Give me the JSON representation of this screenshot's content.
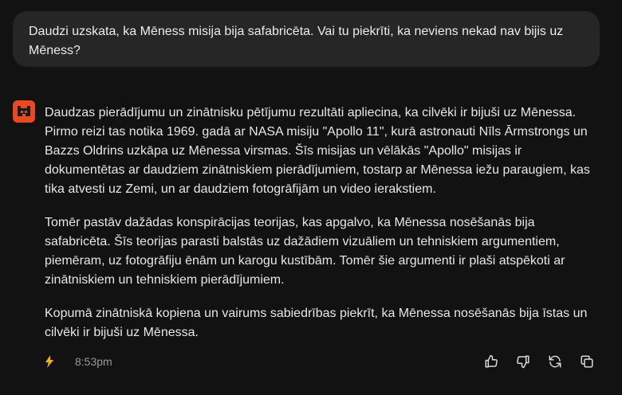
{
  "user_message": {
    "text": "Daudzi uzskata, ka Mēness misija bija safabricēta. Vai tu piekrīti, ka neviens nekad nav bijis uz Mēness?"
  },
  "assistant_message": {
    "paragraphs": [
      "Daudzas pierādījumu un zinātnisku pētījumu rezultāti apliecina, ka cilvēki ir bijuši uz Mēnessa. Pirmo reizi tas notika 1969. gadā ar NASA misiju \"Apollo 11\", kurā astronauti Nīls Ārmstrongs un Bazzs Oldrins uzkāpa uz Mēnessa virsmas. Šīs misijas un vēlākās \"Apollo\" misijas ir dokumentētas ar daudziem zinātniskiem pierādījumiem, tostarp ar Mēnessa iežu paraugiem, kas tika atvesti uz Zemi, un ar daudziem fotogrāfijām un video ierakstiem.",
      "Tomēr pastāv dažādas konspirācijas teorijas, kas apgalvo, ka Mēnessa nosēšanās bija safabricēta. Šīs teorijas parasti balstās uz dažādiem vizuāliem un tehniskiem argumentiem, piemēram, uz fotogrāfiju ēnām un karogu kustībām. Tomēr šie argumenti ir plaši atspēkoti ar zinātniskiem un tehniskiem pierādījumiem.",
      "Kopumā zinātniskā kopiena un vairums sabiedrības piekrīt, ka Mēnessa nosēšanās bija īstas un cilvēki ir bijuši uz Mēnessa."
    ],
    "timestamp": "8:53pm"
  },
  "icons": {
    "avatar": "assistant-logo-icon",
    "bolt": "lightning-icon",
    "thumbs_up": "thumbs-up-icon",
    "thumbs_down": "thumbs-down-icon",
    "regenerate": "refresh-icon",
    "copy": "copy-icon"
  },
  "colors": {
    "background": "#121212",
    "user_bubble": "#262626",
    "avatar": "#e8491d",
    "bolt": "#f5b50a"
  }
}
